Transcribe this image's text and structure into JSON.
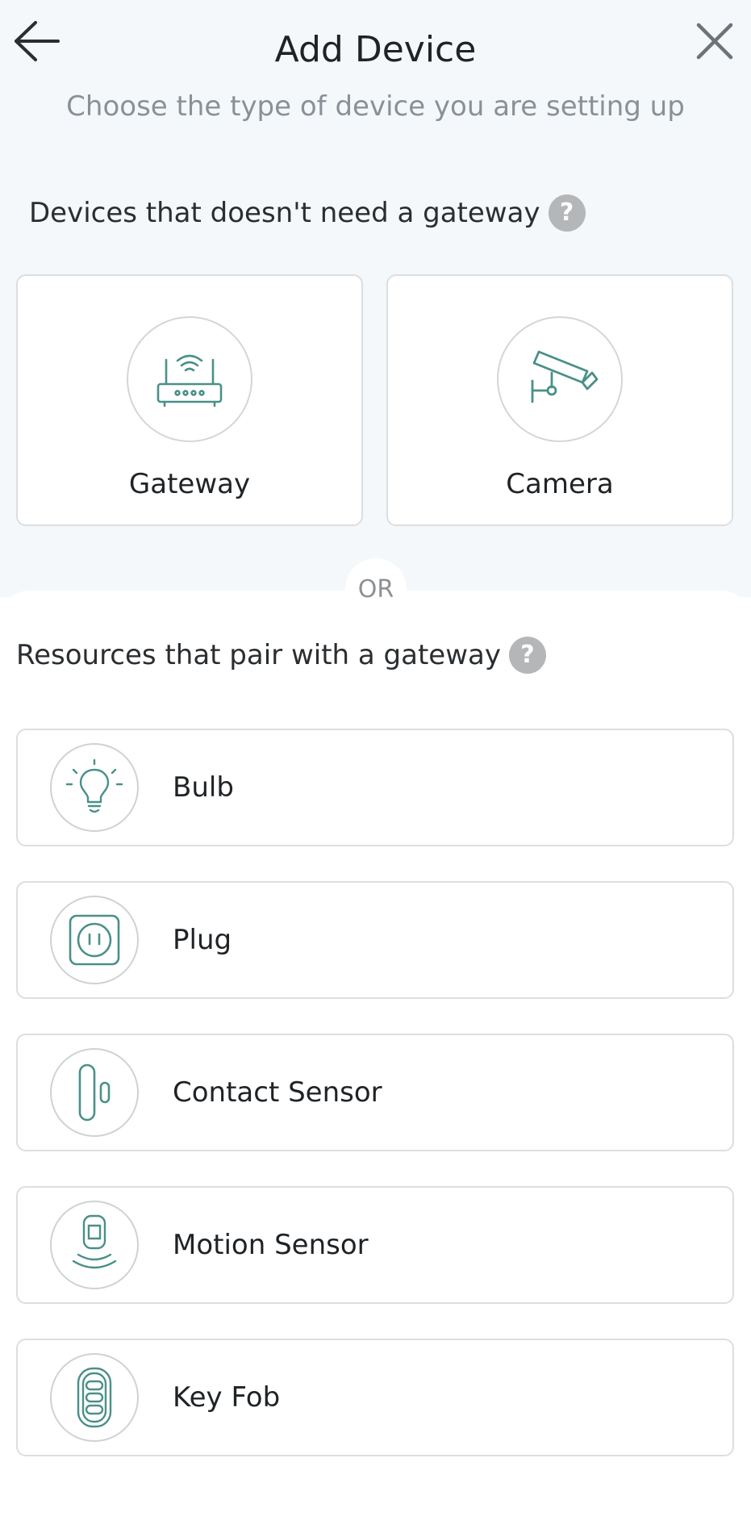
{
  "header": {
    "title": "Add Device",
    "subtitle": "Choose the type of device you are setting up"
  },
  "no_gateway_section": {
    "heading": "Devices that doesn't need a gateway",
    "help_glyph": "?",
    "tiles": [
      {
        "label": "Gateway",
        "icon": "router-icon"
      },
      {
        "label": "Camera",
        "icon": "security-camera-icon"
      }
    ]
  },
  "divider": {
    "label": "OR"
  },
  "gateway_section": {
    "heading": "Resources that pair with a gateway",
    "help_glyph": "?",
    "items": [
      {
        "label": "Bulb",
        "icon": "bulb-icon"
      },
      {
        "label": "Plug",
        "icon": "plug-icon"
      },
      {
        "label": "Contact Sensor",
        "icon": "contact-sensor-icon"
      },
      {
        "label": "Motion Sensor",
        "icon": "motion-sensor-icon"
      },
      {
        "label": "Key Fob",
        "icon": "key-fob-icon"
      }
    ]
  },
  "colors": {
    "accent": "#4a9088",
    "top_background": "#f4f8fb",
    "border": "#dcdedf",
    "help_badge": "#b4b6b8"
  }
}
